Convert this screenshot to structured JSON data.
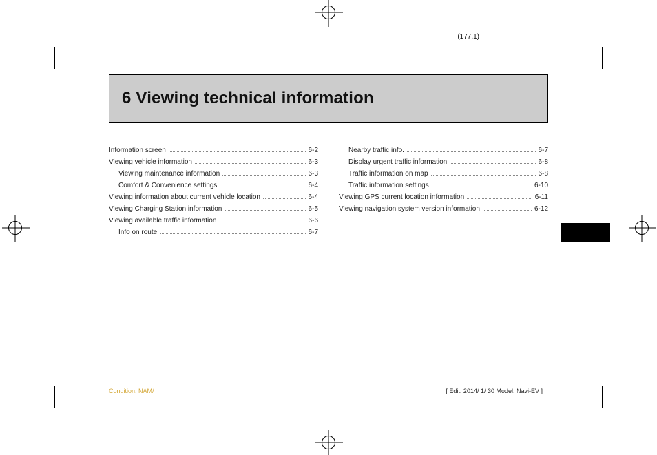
{
  "header": {
    "folio": "(177,1)"
  },
  "title": {
    "full": "6 Viewing technical information"
  },
  "toc": {
    "left": [
      {
        "label": "Information screen",
        "page": "6-2",
        "indent": 0
      },
      {
        "label": "Viewing vehicle information",
        "page": "6-3",
        "indent": 0
      },
      {
        "label": "Viewing maintenance information",
        "page": "6-3",
        "indent": 1
      },
      {
        "label": "Comfort & Convenience settings",
        "page": "6-4",
        "indent": 1
      },
      {
        "label": "Viewing information about current vehicle location",
        "page": "6-4",
        "indent": 0
      },
      {
        "label": "Viewing Charging Station information",
        "page": "6-5",
        "indent": 0
      },
      {
        "label": "Viewing available traffic information",
        "page": "6-6",
        "indent": 0
      },
      {
        "label": "Info on route",
        "page": "6-7",
        "indent": 1
      }
    ],
    "right": [
      {
        "label": "Nearby traffic info.",
        "page": "6-7",
        "indent": 1
      },
      {
        "label": "Display urgent traffic information",
        "page": "6-8",
        "indent": 1
      },
      {
        "label": "Traffic information on map",
        "page": "6-8",
        "indent": 1
      },
      {
        "label": "Traffic information settings",
        "page": "6-10",
        "indent": 1
      },
      {
        "label": "Viewing GPS current location information",
        "page": "6-11",
        "indent": 0
      },
      {
        "label": "Viewing navigation system version information",
        "page": "6-12",
        "indent": 0
      }
    ]
  },
  "footer": {
    "left": "Condition: NAM/",
    "right": "[ Edit: 2014/ 1/ 30   Model: Navi-EV ]"
  }
}
